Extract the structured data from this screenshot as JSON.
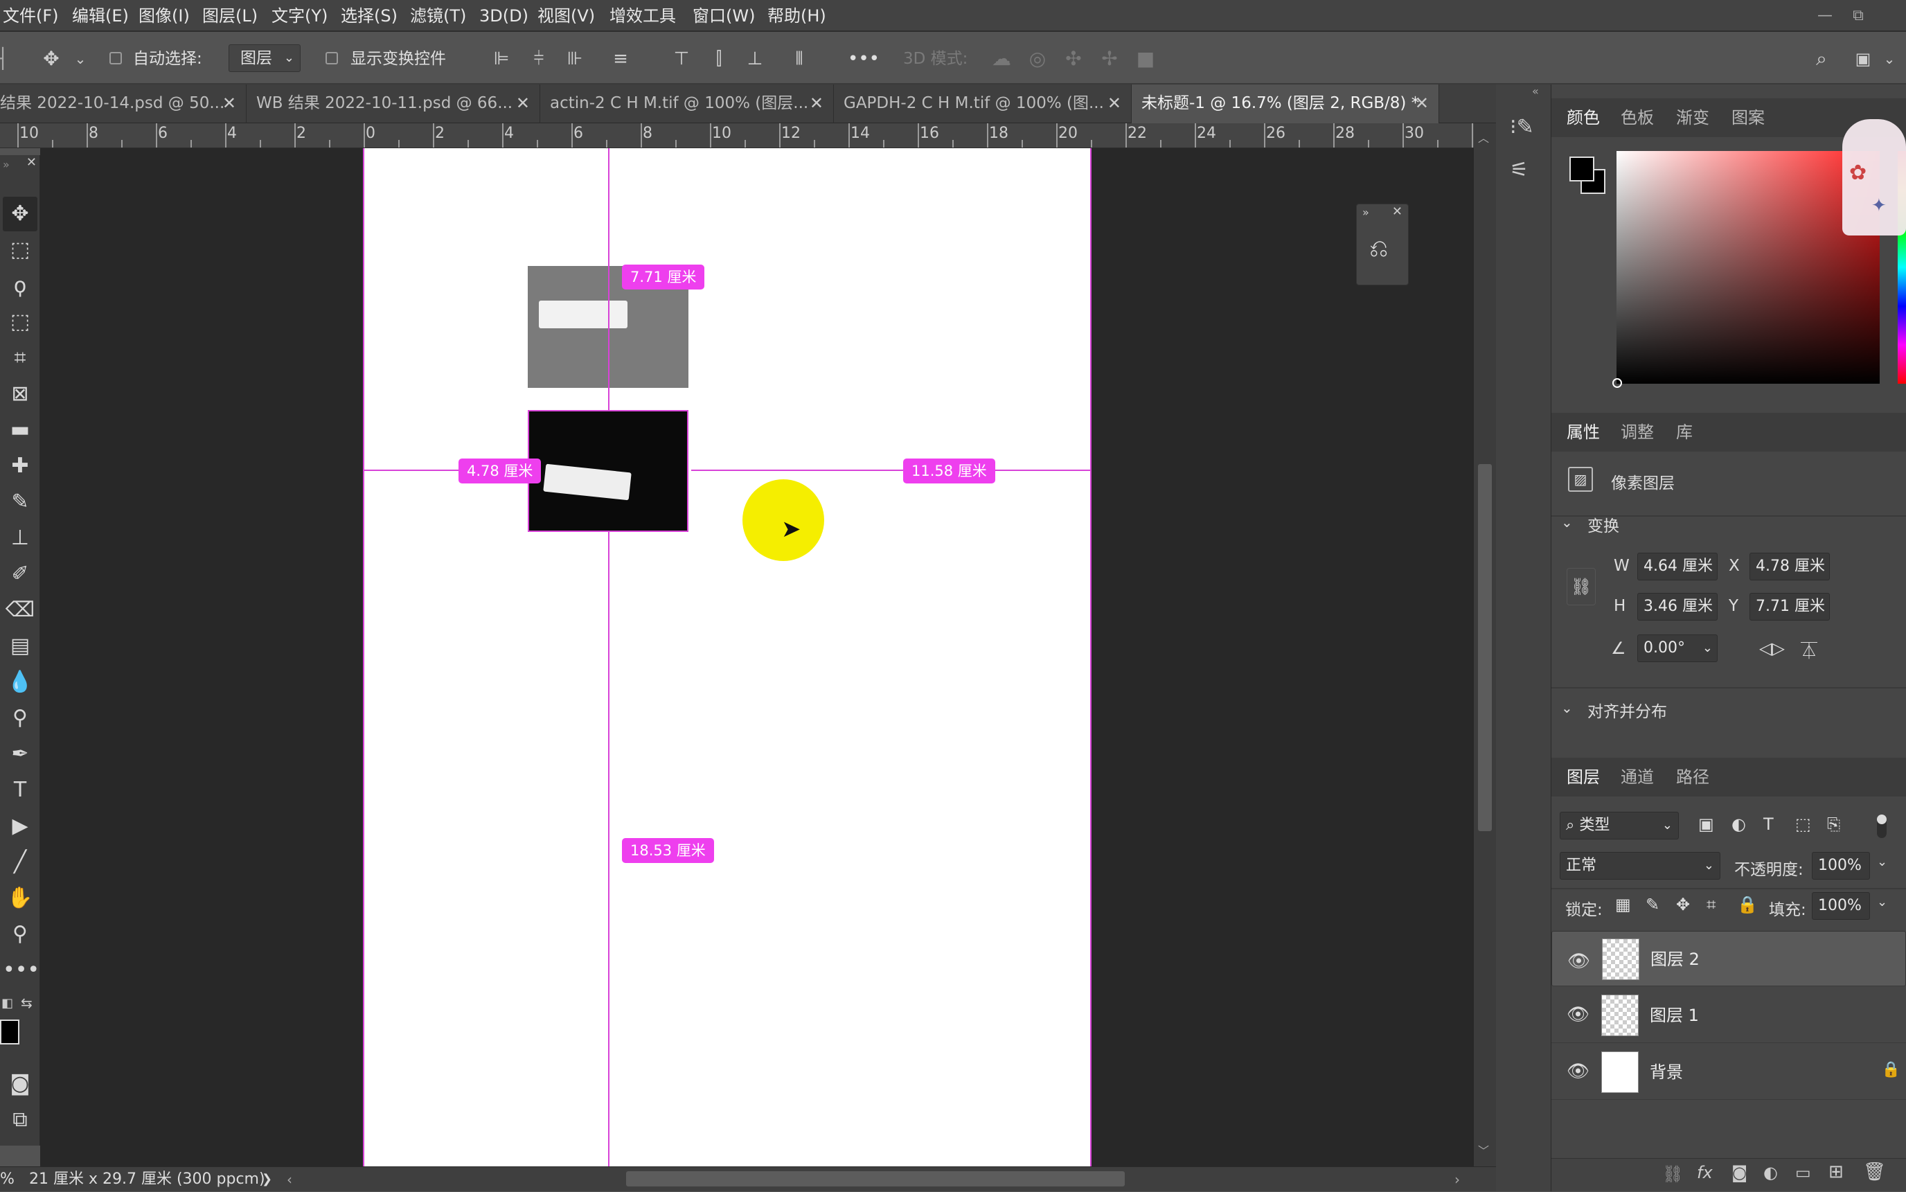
{
  "menu": [
    "文件(F)",
    "编辑(E)",
    "图像(I)",
    "图层(L)",
    "文字(Y)",
    "选择(S)",
    "滤镜(T)",
    "3D(D)",
    "视图(V)",
    "增效工具",
    "窗口(W)",
    "帮助(H)"
  ],
  "window": {
    "minimize": "—",
    "restore": "⧉"
  },
  "options": {
    "auto_select_label": "自动选择:",
    "auto_select_value": "图层",
    "show_transform_label": "显示变换控件",
    "more": "•••",
    "mode3d_label": "3D 模式:"
  },
  "tabs": [
    {
      "label": "结果 2022-10-14.psd @ 50..."
    },
    {
      "label": "WB 结果 2022-10-11.psd @ 66..."
    },
    {
      "label": "actin-2 C H M.tif @ 100% (图层..."
    },
    {
      "label": "GAPDH-2 C H M.tif @ 100% (图..."
    },
    {
      "label": "未标题-1 @ 16.7% (图层 2, RGB/8) *"
    }
  ],
  "ruler_h": [
    "10",
    "8",
    "6",
    "4",
    "2",
    "0",
    "2",
    "4",
    "6",
    "8",
    "10",
    "12",
    "14",
    "16",
    "18",
    "20",
    "22",
    "24",
    "26",
    "28",
    "30"
  ],
  "measurements": {
    "top": "7.71 厘米",
    "left": "4.78 厘米",
    "right": "11.58 厘米",
    "bottom": "18.53 厘米"
  },
  "status": {
    "zoom": "%",
    "doc_size": "21 厘米 x 29.7 厘米 (300 ppcm)",
    "arrow": "❯"
  },
  "panel_color": {
    "tabs": [
      "颜色",
      "色板",
      "渐变",
      "图案"
    ]
  },
  "panel_props": {
    "tabs": [
      "属性",
      "调整",
      "库"
    ],
    "layer_type": "像素图层",
    "transform_title": "变换",
    "w_label": "W",
    "w_value": "4.64 厘米",
    "x_label": "X",
    "x_value": "4.78 厘米",
    "h_label": "H",
    "h_value": "3.46 厘米",
    "y_label": "Y",
    "y_value": "7.71 厘米",
    "angle_value": "0.00°",
    "align_title": "对齐并分布"
  },
  "panel_layers": {
    "tabs": [
      "图层",
      "通道",
      "路径"
    ],
    "filter": "类型",
    "blend": "正常",
    "opacity_label": "不透明度:",
    "opacity_value": "100%",
    "lock_label": "锁定:",
    "fill_label": "填充:",
    "fill_value": "100%",
    "layers": [
      {
        "name": "图层 2",
        "selected": true
      },
      {
        "name": "图层 1",
        "selected": false
      },
      {
        "name": "背景",
        "selected": false
      }
    ]
  },
  "colors": {
    "guide": "#d843d8",
    "label_bg": "#ee3fee",
    "highlight": "#f5ee00"
  }
}
